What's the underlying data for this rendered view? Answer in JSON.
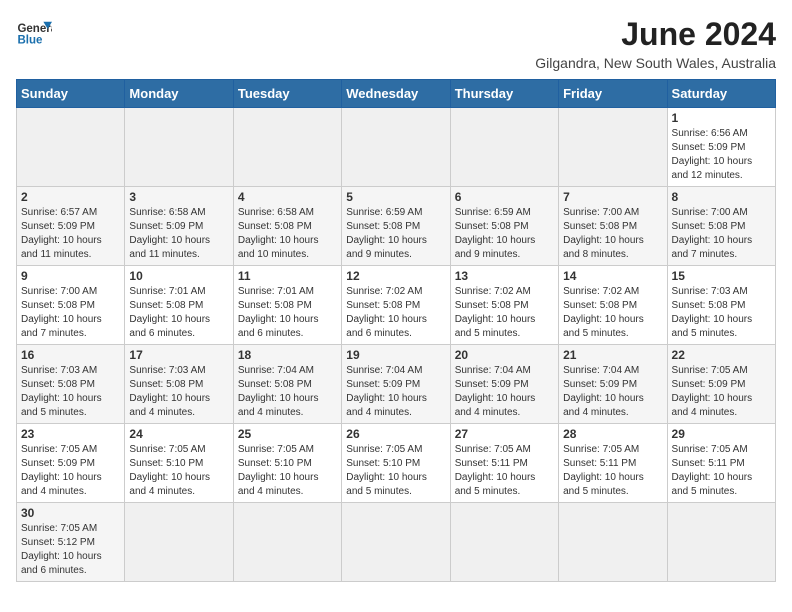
{
  "logo": {
    "line1": "General",
    "line2": "Blue"
  },
  "title": "June 2024",
  "subtitle": "Gilgandra, New South Wales, Australia",
  "weekdays": [
    "Sunday",
    "Monday",
    "Tuesday",
    "Wednesday",
    "Thursday",
    "Friday",
    "Saturday"
  ],
  "days": [
    {
      "num": "",
      "info": "",
      "empty": true
    },
    {
      "num": "",
      "info": "",
      "empty": true
    },
    {
      "num": "",
      "info": "",
      "empty": true
    },
    {
      "num": "",
      "info": "",
      "empty": true
    },
    {
      "num": "",
      "info": "",
      "empty": true
    },
    {
      "num": "",
      "info": "",
      "empty": true
    },
    {
      "num": "1",
      "info": "Sunrise: 6:56 AM\nSunset: 5:09 PM\nDaylight: 10 hours\nand 12 minutes."
    }
  ],
  "week2": [
    {
      "num": "2",
      "info": "Sunrise: 6:57 AM\nSunset: 5:09 PM\nDaylight: 10 hours\nand 11 minutes."
    },
    {
      "num": "3",
      "info": "Sunrise: 6:58 AM\nSunset: 5:09 PM\nDaylight: 10 hours\nand 11 minutes."
    },
    {
      "num": "4",
      "info": "Sunrise: 6:58 AM\nSunset: 5:08 PM\nDaylight: 10 hours\nand 10 minutes."
    },
    {
      "num": "5",
      "info": "Sunrise: 6:59 AM\nSunset: 5:08 PM\nDaylight: 10 hours\nand 9 minutes."
    },
    {
      "num": "6",
      "info": "Sunrise: 6:59 AM\nSunset: 5:08 PM\nDaylight: 10 hours\nand 9 minutes."
    },
    {
      "num": "7",
      "info": "Sunrise: 7:00 AM\nSunset: 5:08 PM\nDaylight: 10 hours\nand 8 minutes."
    },
    {
      "num": "8",
      "info": "Sunrise: 7:00 AM\nSunset: 5:08 PM\nDaylight: 10 hours\nand 7 minutes."
    }
  ],
  "week3": [
    {
      "num": "9",
      "info": "Sunrise: 7:00 AM\nSunset: 5:08 PM\nDaylight: 10 hours\nand 7 minutes."
    },
    {
      "num": "10",
      "info": "Sunrise: 7:01 AM\nSunset: 5:08 PM\nDaylight: 10 hours\nand 6 minutes."
    },
    {
      "num": "11",
      "info": "Sunrise: 7:01 AM\nSunset: 5:08 PM\nDaylight: 10 hours\nand 6 minutes."
    },
    {
      "num": "12",
      "info": "Sunrise: 7:02 AM\nSunset: 5:08 PM\nDaylight: 10 hours\nand 6 minutes."
    },
    {
      "num": "13",
      "info": "Sunrise: 7:02 AM\nSunset: 5:08 PM\nDaylight: 10 hours\nand 5 minutes."
    },
    {
      "num": "14",
      "info": "Sunrise: 7:02 AM\nSunset: 5:08 PM\nDaylight: 10 hours\nand 5 minutes."
    },
    {
      "num": "15",
      "info": "Sunrise: 7:03 AM\nSunset: 5:08 PM\nDaylight: 10 hours\nand 5 minutes."
    }
  ],
  "week4": [
    {
      "num": "16",
      "info": "Sunrise: 7:03 AM\nSunset: 5:08 PM\nDaylight: 10 hours\nand 5 minutes."
    },
    {
      "num": "17",
      "info": "Sunrise: 7:03 AM\nSunset: 5:08 PM\nDaylight: 10 hours\nand 4 minutes."
    },
    {
      "num": "18",
      "info": "Sunrise: 7:04 AM\nSunset: 5:08 PM\nDaylight: 10 hours\nand 4 minutes."
    },
    {
      "num": "19",
      "info": "Sunrise: 7:04 AM\nSunset: 5:09 PM\nDaylight: 10 hours\nand 4 minutes."
    },
    {
      "num": "20",
      "info": "Sunrise: 7:04 AM\nSunset: 5:09 PM\nDaylight: 10 hours\nand 4 minutes."
    },
    {
      "num": "21",
      "info": "Sunrise: 7:04 AM\nSunset: 5:09 PM\nDaylight: 10 hours\nand 4 minutes."
    },
    {
      "num": "22",
      "info": "Sunrise: 7:05 AM\nSunset: 5:09 PM\nDaylight: 10 hours\nand 4 minutes."
    }
  ],
  "week5": [
    {
      "num": "23",
      "info": "Sunrise: 7:05 AM\nSunset: 5:09 PM\nDaylight: 10 hours\nand 4 minutes."
    },
    {
      "num": "24",
      "info": "Sunrise: 7:05 AM\nSunset: 5:10 PM\nDaylight: 10 hours\nand 4 minutes."
    },
    {
      "num": "25",
      "info": "Sunrise: 7:05 AM\nSunset: 5:10 PM\nDaylight: 10 hours\nand 4 minutes."
    },
    {
      "num": "26",
      "info": "Sunrise: 7:05 AM\nSunset: 5:10 PM\nDaylight: 10 hours\nand 5 minutes."
    },
    {
      "num": "27",
      "info": "Sunrise: 7:05 AM\nSunset: 5:11 PM\nDaylight: 10 hours\nand 5 minutes."
    },
    {
      "num": "28",
      "info": "Sunrise: 7:05 AM\nSunset: 5:11 PM\nDaylight: 10 hours\nand 5 minutes."
    },
    {
      "num": "29",
      "info": "Sunrise: 7:05 AM\nSunset: 5:11 PM\nDaylight: 10 hours\nand 5 minutes."
    }
  ],
  "week6": [
    {
      "num": "30",
      "info": "Sunrise: 7:05 AM\nSunset: 5:12 PM\nDaylight: 10 hours\nand 6 minutes."
    },
    {
      "num": "",
      "info": "",
      "empty": true
    },
    {
      "num": "",
      "info": "",
      "empty": true
    },
    {
      "num": "",
      "info": "",
      "empty": true
    },
    {
      "num": "",
      "info": "",
      "empty": true
    },
    {
      "num": "",
      "info": "",
      "empty": true
    },
    {
      "num": "",
      "info": "",
      "empty": true
    }
  ]
}
